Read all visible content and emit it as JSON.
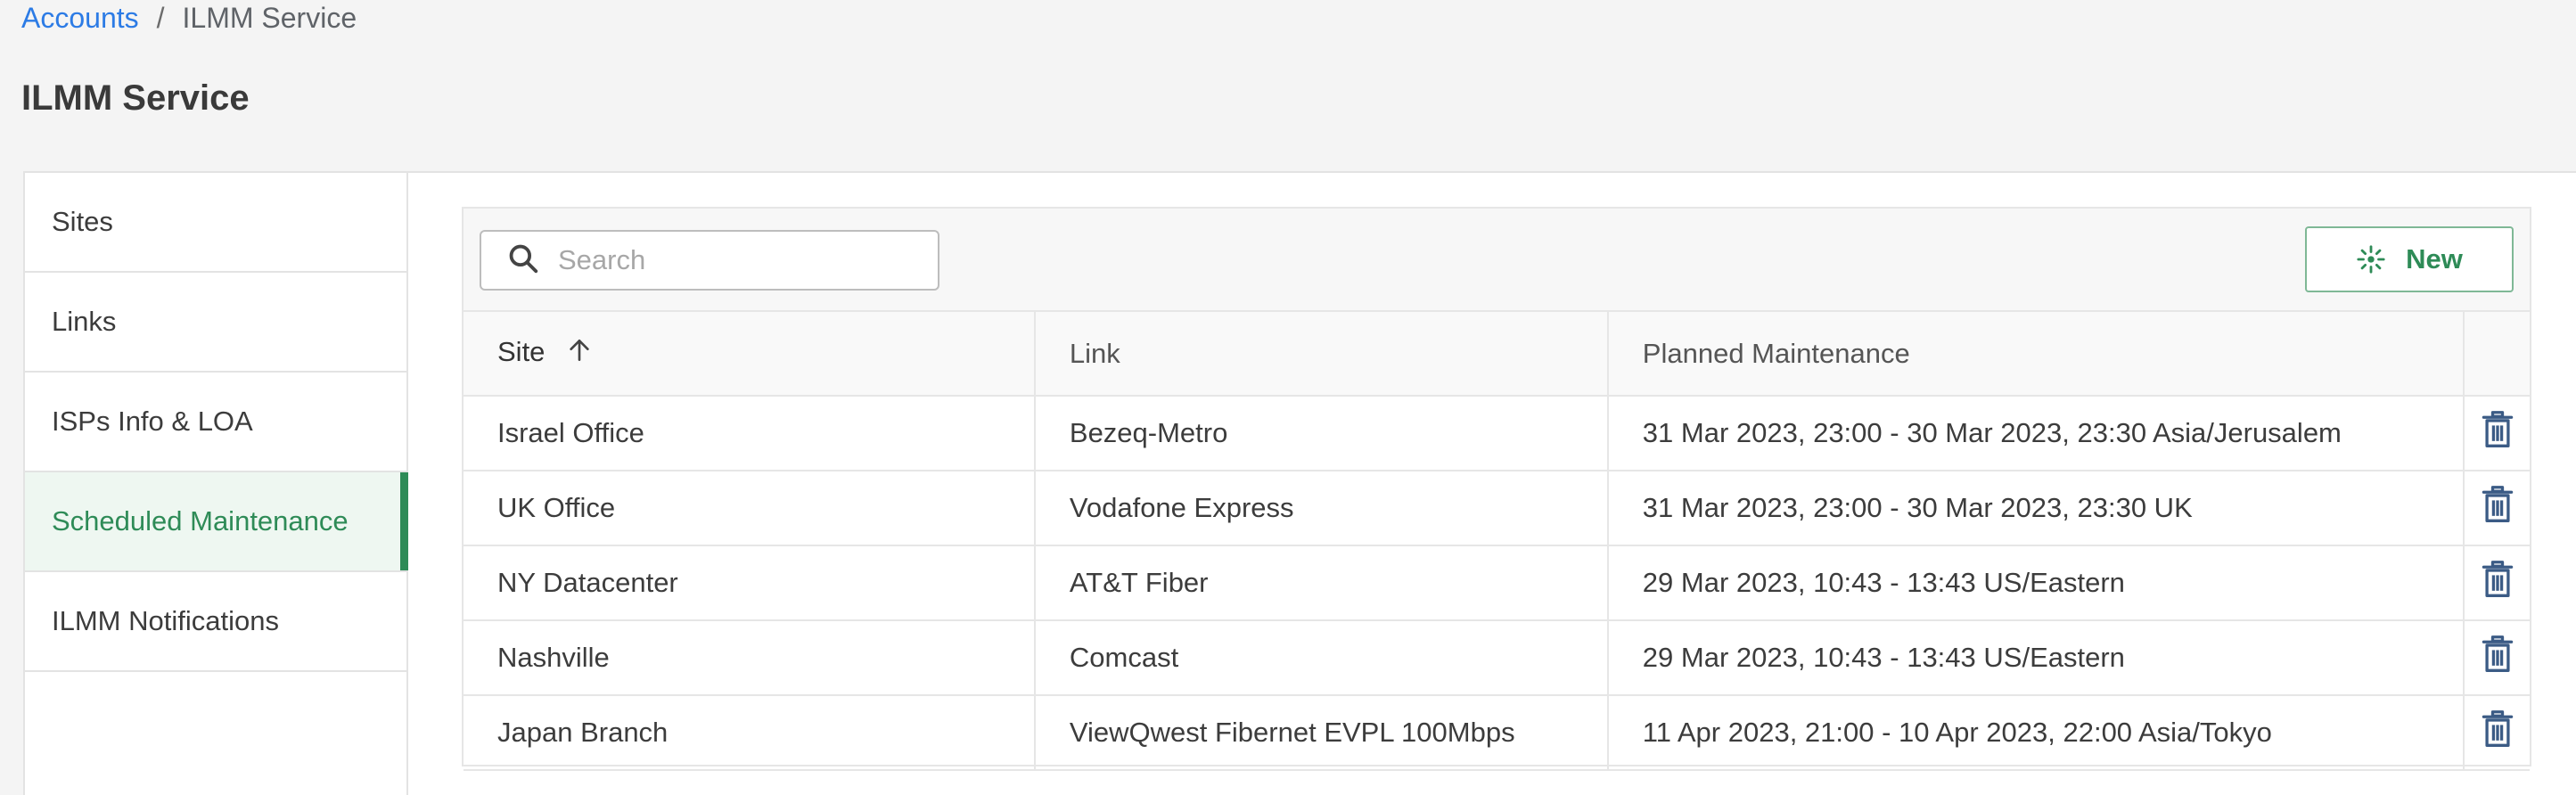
{
  "breadcrumb": {
    "parent": "Accounts",
    "separator": "/",
    "current": "ILMM Service"
  },
  "page": {
    "title": "ILMM Service"
  },
  "sidebar": {
    "items": [
      {
        "label": "Sites"
      },
      {
        "label": "Links"
      },
      {
        "label": "ISPs Info & LOA"
      },
      {
        "label": "Scheduled Maintenance",
        "active": true
      },
      {
        "label": "ILMM Notifications"
      }
    ]
  },
  "toolbar": {
    "search_placeholder": "Search",
    "new_label": "New"
  },
  "table": {
    "headers": {
      "site": "Site",
      "link": "Link",
      "maintenance": "Planned Maintenance"
    },
    "sort": {
      "column": "site",
      "direction": "ascending"
    },
    "rows": [
      {
        "site": "Israel Office",
        "link": "Bezeq-Metro",
        "maintenance": "31 Mar 2023, 23:00 - 30 Mar 2023, 23:30 Asia/Jerusalem"
      },
      {
        "site": "UK Office",
        "link": "Vodafone Express",
        "maintenance": "31 Mar 2023, 23:00 - 30 Mar 2023, 23:30 UK"
      },
      {
        "site": "NY Datacenter",
        "link": "AT&T Fiber",
        "maintenance": "29 Mar 2023, 10:43 - 13:43 US/Eastern"
      },
      {
        "site": "Nashville",
        "link": "Comcast",
        "maintenance": "29 Mar 2023, 10:43 - 13:43 US/Eastern"
      },
      {
        "site": "Japan Branch",
        "link": "ViewQwest Fibernet EVPL 100Mbps",
        "maintenance": "11 Apr 2023, 21:00 - 10 Apr 2023, 22:00 Asia/Tokyo"
      }
    ]
  },
  "colors": {
    "accent": "#2e8b57",
    "link": "#2c7be5",
    "icon": "#3b5b85"
  },
  "icons": {
    "search": "search-icon",
    "new": "sparkle-icon",
    "sort": "arrow-up-icon",
    "delete": "trash-icon"
  }
}
